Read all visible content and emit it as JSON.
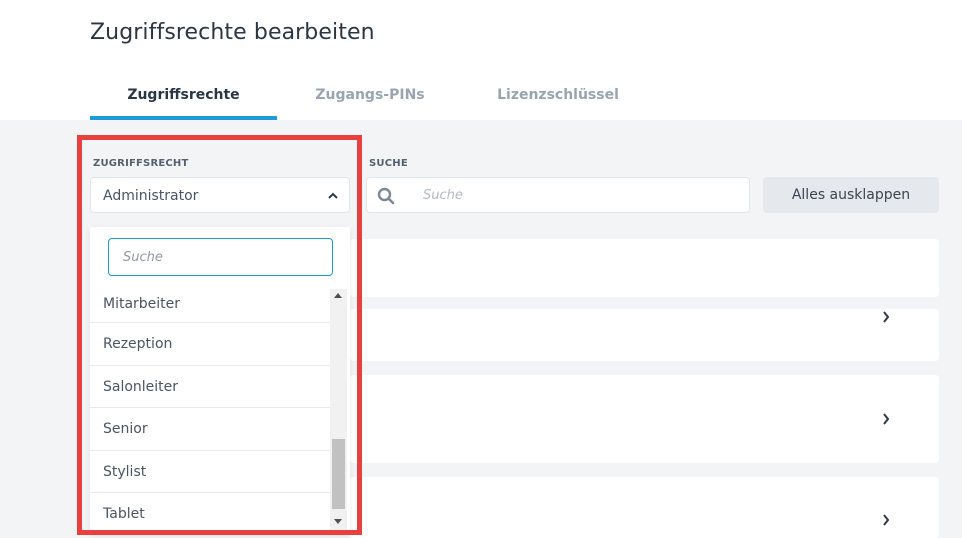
{
  "page": {
    "title": "Zugriffsrechte bearbeiten"
  },
  "tabs": [
    {
      "label": "Zugriffsrechte",
      "active": true
    },
    {
      "label": "Zugangs-PINs",
      "active": false
    },
    {
      "label": "Lizenzschlüssel",
      "active": false
    }
  ],
  "filters": {
    "role_label": "ZUGRIFFSRECHT",
    "role_value": "Administrator",
    "search_label": "SUCHE",
    "search_placeholder": "Suche"
  },
  "expand_button": "Alles ausklappen",
  "dropdown": {
    "search_placeholder": "Suche",
    "items": [
      "Mitarbeiter",
      "Rezeption",
      "Salonleiter",
      "Senior",
      "Stylist",
      "Tablet"
    ]
  },
  "icons": {
    "search": "search-icon",
    "caret": "chevron-up-icon",
    "row_chevron": "chevron-right-icon"
  },
  "colors": {
    "accent": "#1d9bd8",
    "highlight": "#e8403e"
  },
  "cards": [
    {
      "chevron": ""
    },
    {
      "chevron": "›"
    },
    {
      "chevron": "›"
    },
    {
      "chevron": "›"
    }
  ]
}
